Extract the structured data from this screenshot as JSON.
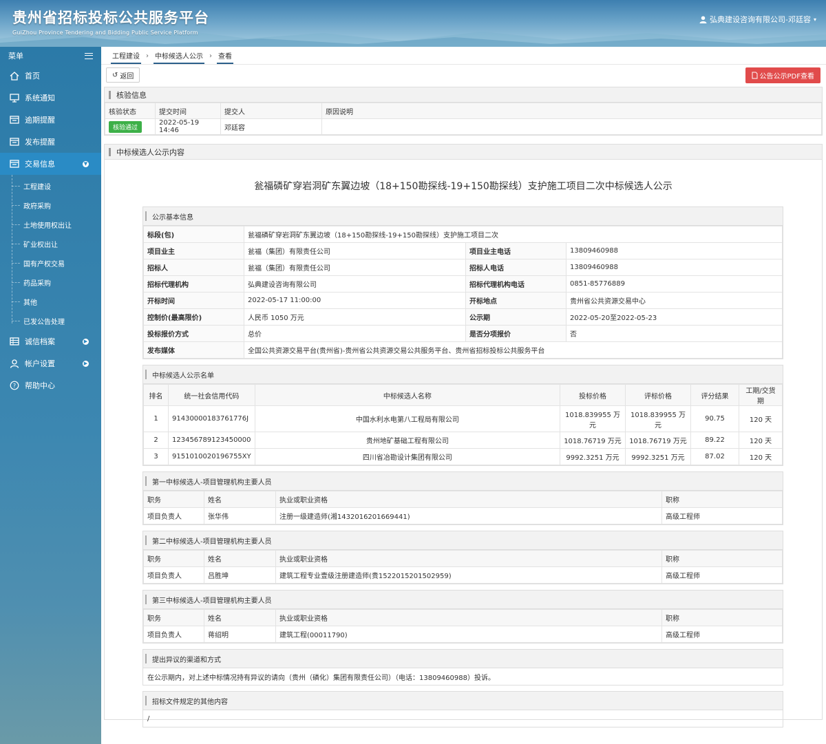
{
  "header": {
    "title_cn": "贵州省招标投标公共服务平台",
    "title_en": "GuiZhou Province Tendering and Bidding Public Service Platform",
    "user": "弘典建设咨询有限公司-邓廷容"
  },
  "sidebar": {
    "menu_label": "菜单",
    "items": [
      {
        "label": "首页",
        "icon": "home-icon"
      },
      {
        "label": "系统通知",
        "icon": "monitor-icon"
      },
      {
        "label": "逾期提醒",
        "icon": "list-icon"
      },
      {
        "label": "发布提醒",
        "icon": "list-icon"
      },
      {
        "label": "交易信息",
        "icon": "list-icon"
      },
      {
        "label": "诚信档案",
        "icon": "table-icon"
      },
      {
        "label": "帐户设置",
        "icon": "user-icon"
      },
      {
        "label": "帮助中心",
        "icon": "help-icon"
      }
    ],
    "sub_items": [
      "工程建设",
      "政府采购",
      "土地使用权出让",
      "矿业权出让",
      "国有产权交易",
      "药品采购",
      "其他",
      "已发公告处理"
    ]
  },
  "breadcrumb": [
    "工程建设",
    "中标候选人公示",
    "查看"
  ],
  "toolbar": {
    "back": "返回",
    "pdf": "公告公示PDF查看"
  },
  "verify": {
    "title": "核验信息",
    "headers": [
      "核验状态",
      "提交时间",
      "提交人",
      "原因说明"
    ],
    "status": "核验通过",
    "time": "2022-05-19 14:46",
    "submitter": "邓廷容",
    "reason": ""
  },
  "content": {
    "title": "中标候选人公示内容",
    "doc_title": "瓮福磷矿穿岩洞矿东翼边坡（18+150勘探线-19+150勘探线）支护施工项目二次中标候选人公示"
  },
  "basic": {
    "title": "公示基本信息",
    "k_section": "标段(包)",
    "v_section": "瓮福磷矿穿岩洞矿东翼边坡（18+150勘探线-19+150勘探线）支护施工项目二次",
    "k_owner": "项目业主",
    "v_owner": "瓮福（集团）有限责任公司",
    "k_owner_tel": "项目业主电话",
    "v_owner_tel": "13809460988",
    "k_tenderer": "招标人",
    "v_tenderer": "瓮福（集团）有限责任公司",
    "k_tenderer_tel": "招标人电话",
    "v_tenderer_tel": "13809460988",
    "k_agency": "招标代理机构",
    "v_agency": "弘典建设咨询有限公司",
    "k_agency_tel": "招标代理机构电话",
    "v_agency_tel": "0851-85776889",
    "k_open_time": "开标时间",
    "v_open_time": "2022-05-17 11:00:00",
    "k_open_place": "开标地点",
    "v_open_place": "贵州省公共资源交易中心",
    "k_price": "控制价(最高限价)",
    "v_price": "人民币 1050 万元",
    "k_period": "公示期",
    "v_period": "2022-05-20至2022-05-23",
    "k_quote": "投标报价方式",
    "v_quote": "总价",
    "k_split": "是否分项报价",
    "v_split": "否",
    "k_media": "发布媒体",
    "v_media": "全国公共资源交易平台(贵州省)-贵州省公共资源交易公共服务平台、贵州省招标投标公共服务平台"
  },
  "candidates": {
    "title": "中标候选人公示名单",
    "headers": [
      "排名",
      "统一社会信用代码",
      "中标候选人名称",
      "投标价格",
      "评标价格",
      "评分结果",
      "工期/交货期"
    ],
    "rows": [
      [
        "1",
        "91430000183761776J",
        "中国水利水电第八工程局有限公司",
        "1018.839955 万元",
        "1018.839955 万元",
        "90.75",
        "120 天"
      ],
      [
        "2",
        "123456789123450000",
        "贵州地矿基础工程有限公司",
        "1018.76719 万元",
        "1018.76719 万元",
        "89.22",
        "120 天"
      ],
      [
        "3",
        "9151010020196755XY",
        "四川省冶勘设计集团有限公司",
        "9992.3251 万元",
        "9992.3251 万元",
        "87.02",
        "120 天"
      ]
    ]
  },
  "staff": {
    "headers": [
      "职务",
      "姓名",
      "执业或职业资格",
      "职称"
    ],
    "groups": [
      {
        "title": "第一中标候选人-项目管理机构主要人员",
        "row": [
          "项目负责人",
          "张华伟",
          "注册一级建造师(湘1432016201669441)",
          "高级工程师"
        ]
      },
      {
        "title": "第二中标候选人-项目管理机构主要人员",
        "row": [
          "项目负责人",
          "吕胜坤",
          "建筑工程专业壹级注册建造师(贵1522015201502959)",
          "高级工程师"
        ]
      },
      {
        "title": "第三中标候选人-项目管理机构主要人员",
        "row": [
          "项目负责人",
          "蒋绍明",
          "建筑工程(00011790)",
          "高级工程师"
        ]
      }
    ]
  },
  "objection": {
    "title": "提出异议的渠道和方式",
    "text": "在公示期内，对上述中标情况持有异议的请向（贵州（磷化）集团有限责任公司）（电话：13809460988）投诉。"
  },
  "other": {
    "title": "招标文件规定的其他内容",
    "text": "/"
  }
}
